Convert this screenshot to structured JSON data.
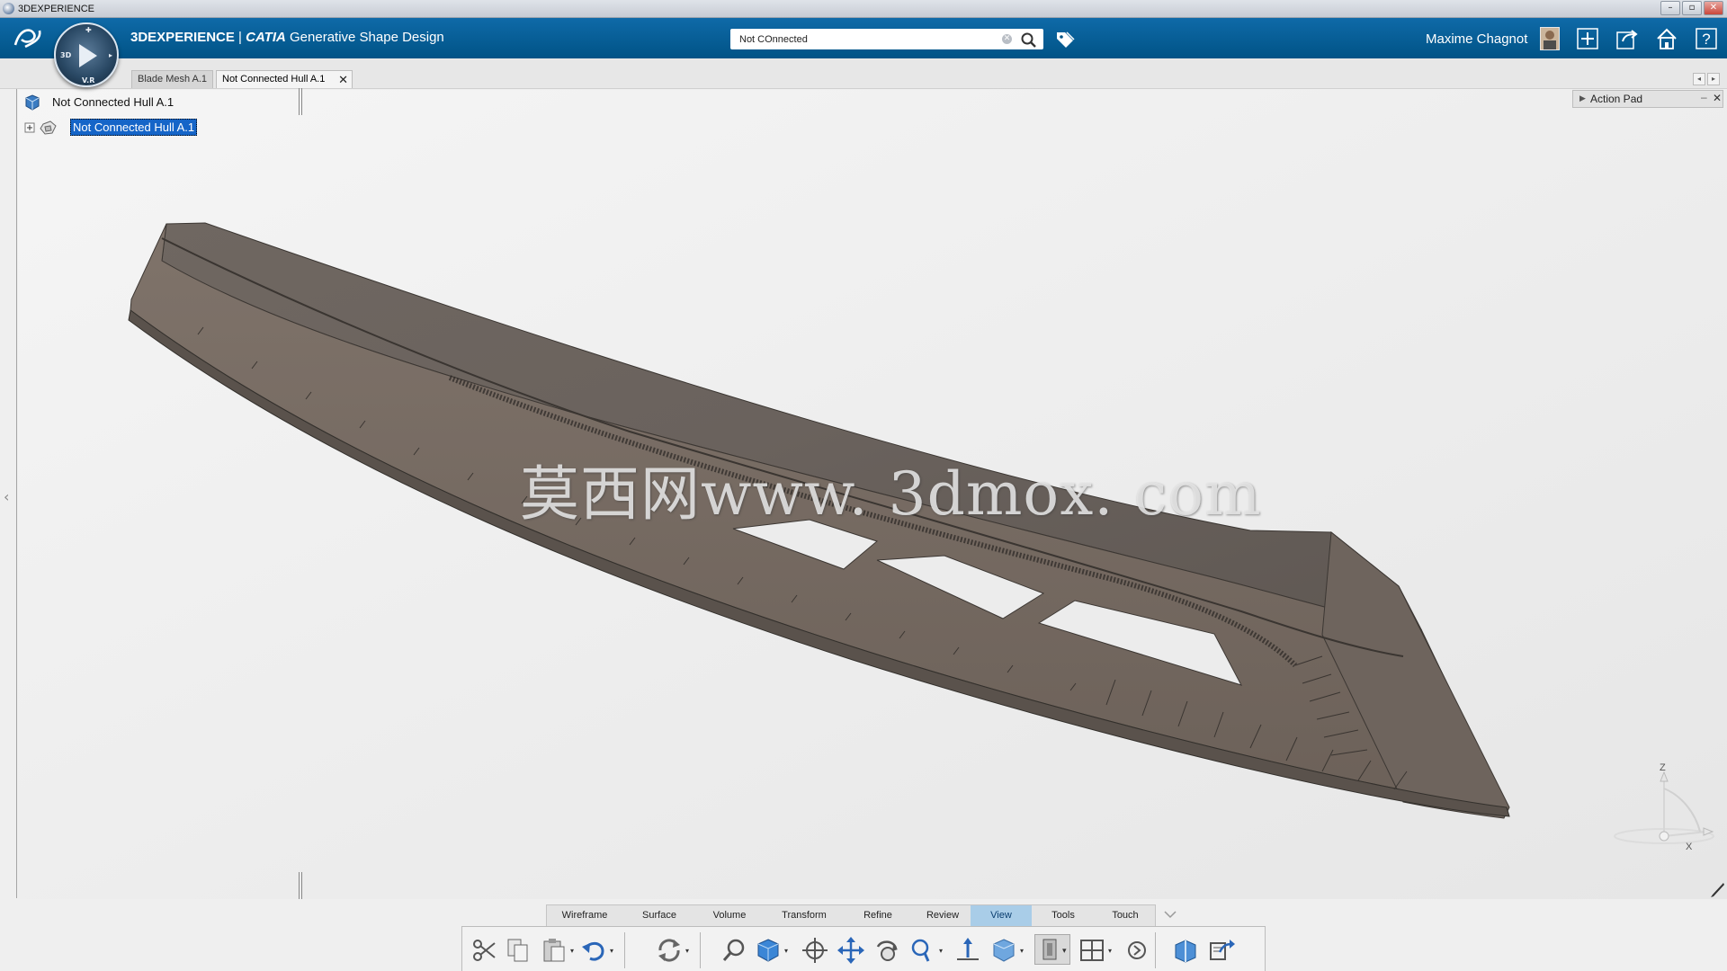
{
  "os": {
    "title": "3DEXPERIENCE",
    "buttons": [
      "–",
      "▫",
      "✕"
    ]
  },
  "header": {
    "brand_prefix": "3DEXPERIENCE",
    "brand_separator": " | ",
    "brand_product": "CATIA",
    "brand_app": "Generative Shape Design",
    "search_value": "Not COnnected",
    "user_name": "Maxime Chagnot"
  },
  "tabs": [
    {
      "label": "Blade Mesh A.1",
      "active": false
    },
    {
      "label": "Not Connected Hull A.1",
      "active": true
    }
  ],
  "tree": {
    "root_label": "Not Connected Hull A.1",
    "child_label": "Not Connected Hull A.1"
  },
  "action_pad": {
    "label": "Action Pad"
  },
  "watermark": "莫西网www. 3dmox. com",
  "triad": {
    "z": "Z",
    "x": "X"
  },
  "section_tabs": [
    {
      "label": "Wireframe",
      "active": false
    },
    {
      "label": "Surface",
      "active": false
    },
    {
      "label": "Volume",
      "active": false
    },
    {
      "label": "Transform",
      "active": false
    },
    {
      "label": "Refine",
      "active": false
    },
    {
      "label": "Review",
      "active": false
    },
    {
      "label": "View",
      "active": true
    },
    {
      "label": "Tools",
      "active": false
    },
    {
      "label": "Touch",
      "active": false
    }
  ],
  "toolbar_icons": [
    "cut-icon",
    "copy-icon",
    "paste-icon",
    "undo-icon",
    "update-icon",
    "fit-all-icon",
    "view-cube-icon",
    "center-icon",
    "pan-icon",
    "rotate-icon",
    "zoom-icon",
    "normal-view-icon",
    "render-style-icon",
    "hide-show-icon",
    "layout-icon",
    "more-icon",
    "sectioning-icon",
    "share-icon"
  ],
  "colors": {
    "header_blue": "#005386",
    "selection_blue": "#1565c8",
    "active_tab": "#a9cde8",
    "hull_face": "#7b7068"
  }
}
